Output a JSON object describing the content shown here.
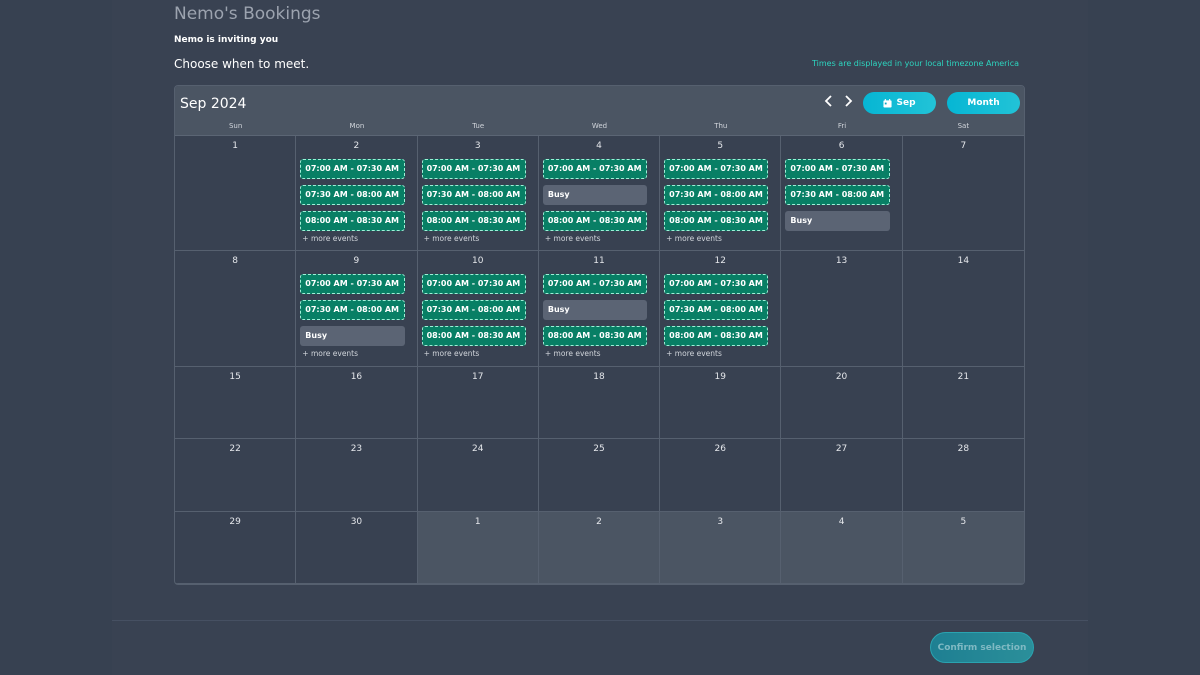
{
  "header": {
    "page_title": "Nemo's Bookings",
    "invite_text": "Nemo is inviting you",
    "choose_text": "Choose when to meet.",
    "timezone_note": "Times are displayed in your local timezone America"
  },
  "calendar": {
    "month_label": "Sep 2024",
    "prev_icon": "chevron-left-icon",
    "next_icon": "chevron-right-icon",
    "current_button_label": "Sep",
    "view_button_label": "Month",
    "weekdays": [
      "Sun",
      "Mon",
      "Tue",
      "Wed",
      "Thu",
      "Fri",
      "Sat"
    ],
    "more_label": "+ more events",
    "busy_label": "Busy",
    "slot_color": "#087f65",
    "busy_color": "#5b6474",
    "accent_color": "#06b6d4",
    "weeks": [
      [
        {
          "day": "1",
          "outside": false,
          "events": [],
          "more": false
        },
        {
          "day": "2",
          "outside": false,
          "events": [
            {
              "type": "slot",
              "label": "07:00 AM - 07:30 AM"
            },
            {
              "type": "slot",
              "label": "07:30 AM - 08:00 AM"
            },
            {
              "type": "slot",
              "label": "08:00 AM - 08:30 AM"
            }
          ],
          "more": true
        },
        {
          "day": "3",
          "outside": false,
          "events": [
            {
              "type": "slot",
              "label": "07:00 AM - 07:30 AM"
            },
            {
              "type": "slot",
              "label": "07:30 AM - 08:00 AM"
            },
            {
              "type": "slot",
              "label": "08:00 AM - 08:30 AM"
            }
          ],
          "more": true
        },
        {
          "day": "4",
          "outside": false,
          "events": [
            {
              "type": "slot",
              "label": "07:00 AM - 07:30 AM"
            },
            {
              "type": "busy",
              "label": "Busy"
            },
            {
              "type": "slot",
              "label": "08:00 AM - 08:30 AM"
            }
          ],
          "more": true
        },
        {
          "day": "5",
          "outside": false,
          "events": [
            {
              "type": "slot",
              "label": "07:00 AM - 07:30 AM"
            },
            {
              "type": "slot",
              "label": "07:30 AM - 08:00 AM"
            },
            {
              "type": "slot",
              "label": "08:00 AM - 08:30 AM"
            }
          ],
          "more": true
        },
        {
          "day": "6",
          "outside": false,
          "events": [
            {
              "type": "slot",
              "label": "07:00 AM - 07:30 AM"
            },
            {
              "type": "slot",
              "label": "07:30 AM - 08:00 AM"
            },
            {
              "type": "busy",
              "label": "Busy"
            }
          ],
          "more": false
        },
        {
          "day": "7",
          "outside": false,
          "events": [],
          "more": false
        }
      ],
      [
        {
          "day": "8",
          "outside": false,
          "events": [],
          "more": false
        },
        {
          "day": "9",
          "outside": false,
          "events": [
            {
              "type": "slot",
              "label": "07:00 AM - 07:30 AM"
            },
            {
              "type": "slot",
              "label": "07:30 AM - 08:00 AM"
            },
            {
              "type": "busy",
              "label": "Busy"
            }
          ],
          "more": true
        },
        {
          "day": "10",
          "outside": false,
          "events": [
            {
              "type": "slot",
              "label": "07:00 AM - 07:30 AM"
            },
            {
              "type": "slot",
              "label": "07:30 AM - 08:00 AM"
            },
            {
              "type": "slot",
              "label": "08:00 AM - 08:30 AM"
            }
          ],
          "more": true
        },
        {
          "day": "11",
          "outside": false,
          "events": [
            {
              "type": "slot",
              "label": "07:00 AM - 07:30 AM"
            },
            {
              "type": "busy",
              "label": "Busy"
            },
            {
              "type": "slot",
              "label": "08:00 AM - 08:30 AM"
            }
          ],
          "more": true
        },
        {
          "day": "12",
          "outside": false,
          "events": [
            {
              "type": "slot",
              "label": "07:00 AM - 07:30 AM"
            },
            {
              "type": "slot",
              "label": "07:30 AM - 08:00 AM"
            },
            {
              "type": "slot",
              "label": "08:00 AM - 08:30 AM"
            }
          ],
          "more": true
        },
        {
          "day": "13",
          "outside": false,
          "events": [],
          "more": false
        },
        {
          "day": "14",
          "outside": false,
          "events": [],
          "more": false
        }
      ],
      [
        {
          "day": "15",
          "outside": false,
          "events": [],
          "more": false
        },
        {
          "day": "16",
          "outside": false,
          "events": [],
          "more": false
        },
        {
          "day": "17",
          "outside": false,
          "events": [],
          "more": false
        },
        {
          "day": "18",
          "outside": false,
          "events": [],
          "more": false
        },
        {
          "day": "19",
          "outside": false,
          "events": [],
          "more": false
        },
        {
          "day": "20",
          "outside": false,
          "events": [],
          "more": false
        },
        {
          "day": "21",
          "outside": false,
          "events": [],
          "more": false
        }
      ],
      [
        {
          "day": "22",
          "outside": false,
          "events": [],
          "more": false
        },
        {
          "day": "23",
          "outside": false,
          "events": [],
          "more": false
        },
        {
          "day": "24",
          "outside": false,
          "events": [],
          "more": false
        },
        {
          "day": "25",
          "outside": false,
          "events": [],
          "more": false
        },
        {
          "day": "26",
          "outside": false,
          "events": [],
          "more": false
        },
        {
          "day": "27",
          "outside": false,
          "events": [],
          "more": false
        },
        {
          "day": "28",
          "outside": false,
          "events": [],
          "more": false
        }
      ],
      [
        {
          "day": "29",
          "outside": false,
          "events": [],
          "more": false
        },
        {
          "day": "30",
          "outside": false,
          "events": [],
          "more": false
        },
        {
          "day": "1",
          "outside": true,
          "events": [],
          "more": false
        },
        {
          "day": "2",
          "outside": true,
          "events": [],
          "more": false
        },
        {
          "day": "3",
          "outside": true,
          "events": [],
          "more": false
        },
        {
          "day": "4",
          "outside": true,
          "events": [],
          "more": false
        },
        {
          "day": "5",
          "outside": true,
          "events": [],
          "more": false
        }
      ]
    ]
  },
  "footer": {
    "confirm_label": "Confirm selection"
  }
}
